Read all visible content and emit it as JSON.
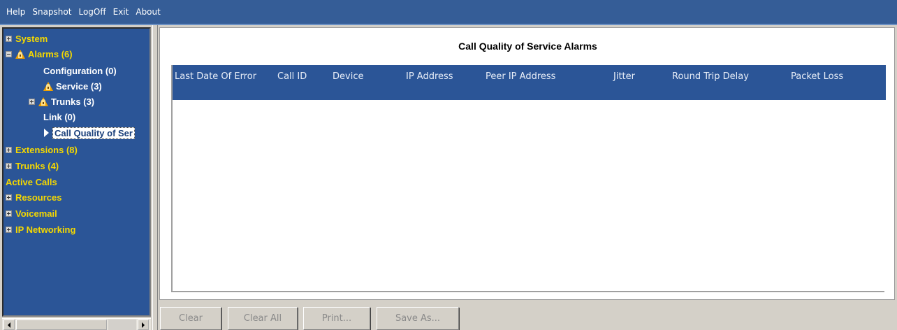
{
  "menu": [
    "Help",
    "Snapshot",
    "LogOff",
    "Exit",
    "About"
  ],
  "tree": [
    {
      "label": "System",
      "expander": "plus",
      "level": 0,
      "warn": false
    },
    {
      "label": "Alarms (6)",
      "expander": "minus",
      "level": 0,
      "warn": true
    },
    {
      "label": "Configuration (0)",
      "expander": null,
      "level": 1,
      "warn": false
    },
    {
      "label": "Service (3)",
      "expander": null,
      "level": 1,
      "warn": true
    },
    {
      "label": "Trunks (3)",
      "expander": "plus",
      "level": 1,
      "warn": true
    },
    {
      "label": "Link (0)",
      "expander": null,
      "level": 1,
      "warn": false
    },
    {
      "label": "Call Quality of Ser",
      "expander": null,
      "level": 1,
      "selected": true
    },
    {
      "label": "Extensions (8)",
      "expander": "plus",
      "level": 0,
      "warn": false
    },
    {
      "label": "Trunks (4)",
      "expander": "plus",
      "level": 0,
      "warn": false
    },
    {
      "label": "Active Calls",
      "expander": null,
      "level": 0,
      "warn": false
    },
    {
      "label": "Resources",
      "expander": "plus",
      "level": 0,
      "warn": false
    },
    {
      "label": "Voicemail",
      "expander": "plus",
      "level": 0,
      "warn": false
    },
    {
      "label": "IP Networking",
      "expander": "plus",
      "level": 0,
      "warn": false
    }
  ],
  "main": {
    "title": "Call Quality of Service Alarms",
    "columns": [
      "Last Date Of Error",
      "Call ID",
      "Device",
      "IP Address",
      "Peer IP Address",
      "Jitter",
      "Round Trip Delay",
      "Packet Loss"
    ]
  },
  "buttons": {
    "clear": "Clear",
    "clear_all": "Clear All",
    "print": "Print...",
    "save_as": "Save As..."
  },
  "colors": {
    "menubar": "#355d97",
    "tree_bg": "#2b5597",
    "tree_text": "#f5d800",
    "table_header": "#2b5597",
    "warning": "#f0a000"
  }
}
